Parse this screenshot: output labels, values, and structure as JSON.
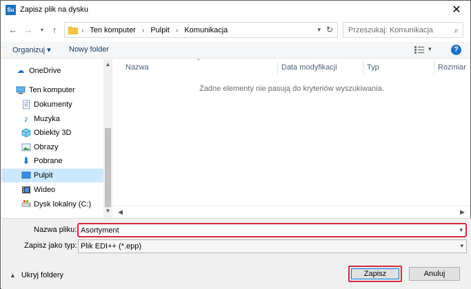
{
  "window": {
    "app_icon_text": "Su",
    "title": "Zapisz plik na dysku",
    "close_glyph": "✕"
  },
  "address_bar": {
    "crumbs": [
      "Ten komputer",
      "Pulpit",
      "Komunikacja"
    ],
    "search_placeholder": "Przeszukaj: Komunikacja"
  },
  "toolbar": {
    "organize_label": "Organizuj ▾",
    "new_folder_label": "Nowy folder",
    "help_label": "?"
  },
  "navigation_pane": {
    "items": [
      {
        "label": "OneDrive",
        "icon": "cloud-icon"
      },
      {
        "label": "Ten komputer",
        "icon": "computer-icon"
      },
      {
        "label": "Dokumenty",
        "icon": "document-icon"
      },
      {
        "label": "Muzyka",
        "icon": "music-icon"
      },
      {
        "label": "Obiekty 3D",
        "icon": "cube-icon"
      },
      {
        "label": "Obrazy",
        "icon": "pictures-icon"
      },
      {
        "label": "Pobrane",
        "icon": "download-icon"
      },
      {
        "label": "Pulpit",
        "icon": "desktop-icon",
        "selected": true
      },
      {
        "label": "Wideo",
        "icon": "video-icon"
      },
      {
        "label": "Dysk lokalny (C:)",
        "icon": "drive-icon"
      }
    ]
  },
  "file_list": {
    "columns": [
      "Nazwa",
      "Data modyfikacji",
      "Typ",
      "Rozmiar"
    ],
    "empty_message": "Żadne elementy nie pasują do kryteriów wyszukiwania."
  },
  "form": {
    "filename_label": "Nazwa pliku:",
    "filename_value": "Asortyment",
    "filetype_label": "Zapisz jako typ:",
    "filetype_value": "Plik EDI++ (*.epp)",
    "hide_folders_label": "Ukryj foldery",
    "save_label": "Zapisz",
    "cancel_label": "Anuluj"
  },
  "colors": {
    "accent": "#1e6fc4",
    "highlight_border": "#d9263a",
    "selection": "#cce8ff"
  }
}
